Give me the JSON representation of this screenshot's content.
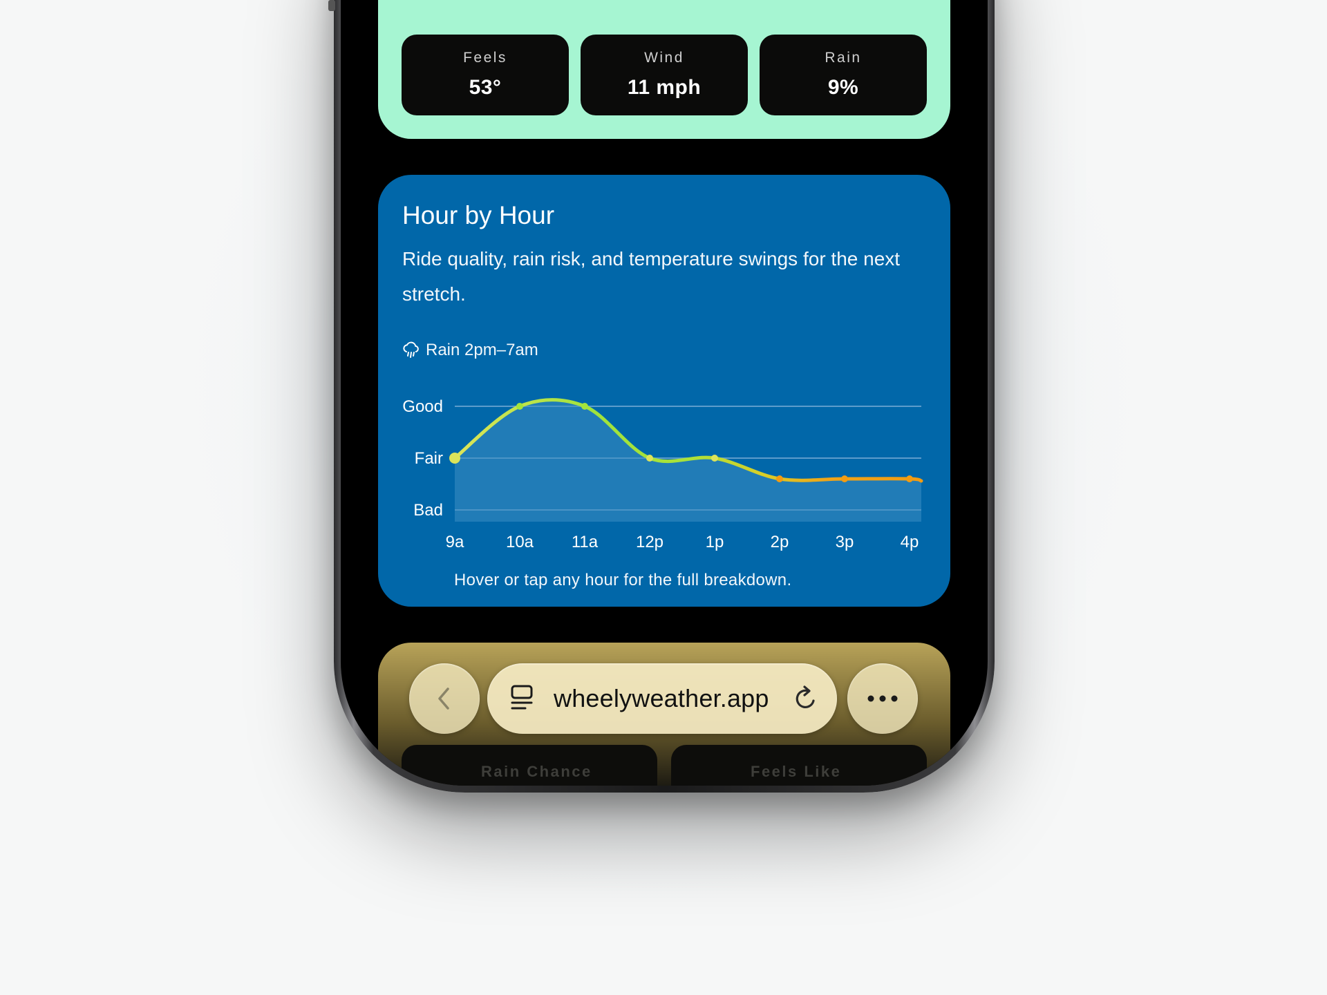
{
  "stats": [
    {
      "label": "Feels",
      "value": "53°"
    },
    {
      "label": "Wind",
      "value": "11 mph"
    },
    {
      "label": "Rain",
      "value": "9%"
    }
  ],
  "hour_card": {
    "title": "Hour by Hour",
    "description": "Ride quality, rain risk, and temperature swings for the next stretch.",
    "rain_note": "Rain 2pm–7am",
    "hint": "Hover or tap any hour for the full breakdown."
  },
  "chart_data": {
    "type": "area",
    "categories": [
      "9a",
      "10a",
      "11a",
      "12p",
      "1p",
      "2p",
      "3p",
      "4p"
    ],
    "y_categories": [
      "Bad",
      "Fair",
      "Good"
    ],
    "values": [
      1.0,
      2.0,
      2.0,
      1.0,
      1.0,
      0.6,
      0.6,
      0.6
    ],
    "ylim": [
      0,
      2
    ],
    "grid": true,
    "colors": {
      "good": "#a4e43b",
      "fair": "#dde45a",
      "bad": "#f39c12",
      "fill": "#3d8ec2",
      "grid": "#5d9ccb"
    }
  },
  "ride_card": {
    "tiles": [
      {
        "label": "Rain Chance"
      },
      {
        "label": "Feels Like"
      }
    ]
  },
  "browser": {
    "url": "wheelyweather.app",
    "back_icon": "chevron-left-icon",
    "tabs_icon": "tabs-icon",
    "reload_icon": "reload-icon",
    "more_icon": "more-icon"
  },
  "colors": {
    "summary_bg": "#a6f5d2",
    "hour_bg": "#0167a9",
    "tile_bg": "#0b0b0a",
    "browser_pill": "#f4eac2"
  }
}
